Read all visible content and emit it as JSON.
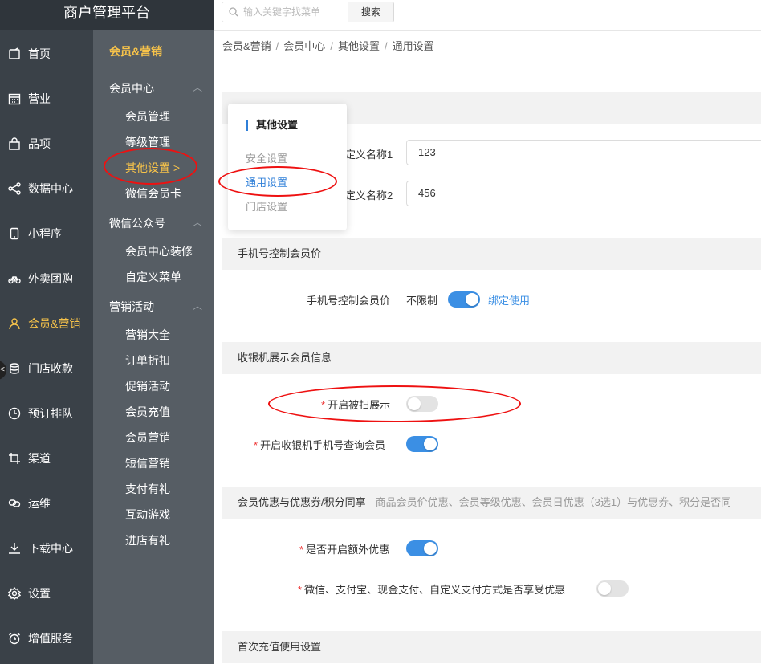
{
  "app": {
    "title": "商户管理平台"
  },
  "search": {
    "placeholder": "输入关键字找菜单",
    "button_label": "搜索"
  },
  "nav": {
    "items": [
      {
        "label": "首页",
        "icon": "home-icon"
      },
      {
        "label": "营业",
        "icon": "calendar-icon"
      },
      {
        "label": "品项",
        "icon": "bag-icon"
      },
      {
        "label": "数据中心",
        "icon": "share-icon"
      },
      {
        "label": "小程序",
        "icon": "phone-icon"
      },
      {
        "label": "外卖团购",
        "icon": "bike-icon"
      },
      {
        "label": "会员&营销",
        "icon": "user-icon",
        "active": true
      },
      {
        "label": "门店收款",
        "icon": "coins-icon"
      },
      {
        "label": "预订排队",
        "icon": "clock-icon"
      },
      {
        "label": "渠道",
        "icon": "crop-icon"
      },
      {
        "label": "运维",
        "icon": "link-icon"
      },
      {
        "label": "下载中心",
        "icon": "download-icon"
      },
      {
        "label": "设置",
        "icon": "gear-icon"
      },
      {
        "label": "增值服务",
        "icon": "alarm-icon"
      }
    ],
    "collapse_glyph": "<"
  },
  "subnav": {
    "title": "会员&营销",
    "groups": [
      {
        "label": "会员中心",
        "items": [
          "会员管理",
          "等级管理",
          "其他设置 >",
          "微信会员卡"
        ]
      },
      {
        "label": "微信公众号",
        "items": [
          "会员中心装修",
          "自定义菜单"
        ]
      },
      {
        "label": "营销活动",
        "items": [
          "营销大全",
          "订单折扣",
          "促销活动",
          "会员充值",
          "会员营销",
          "短信营销",
          "支付有礼",
          "互动游戏",
          "进店有礼"
        ]
      }
    ],
    "active_item": "其他设置 >"
  },
  "breadcrumb": [
    "会员&营销",
    "会员中心",
    "其他设置",
    "通用设置"
  ],
  "popup": {
    "title": "其他设置",
    "items": [
      "安全设置",
      "通用设置",
      "门店设置"
    ],
    "active": "通用设置"
  },
  "custom_fields": [
    {
      "label": "定义名称1",
      "value": "123"
    },
    {
      "label": "定义名称2",
      "value": "456"
    }
  ],
  "sections": {
    "phone": {
      "header": "手机号控制会员价",
      "row_label": "手机号控制会员价",
      "left_text": "不限制",
      "right_text": "绑定使用",
      "switch_on": true
    },
    "cashier": {
      "header": "收银机展示会员信息",
      "rows": [
        {
          "label": "开启被扫展示",
          "on": false
        },
        {
          "label": "开启收银机手机号查询会员",
          "on": true
        }
      ]
    },
    "discount": {
      "header": "会员优惠与优惠券/积分同享",
      "note": "商品会员价优惠、会员等级优惠、会员日优惠（3选1）与优惠券、积分是否同",
      "rows": [
        {
          "label": "是否开启额外优惠",
          "on": true
        },
        {
          "label": "微信、支付宝、现金支付、自定义支付方式是否享受优惠",
          "on": false
        }
      ]
    },
    "recharge": {
      "header": "首次充值使用设置"
    }
  },
  "colors": {
    "accent": "#3b8fe4",
    "nav_active": "#f7c34a",
    "nav_bg": "#3a4148",
    "subnav_bg": "#565d64",
    "annotation": "#e11111"
  }
}
